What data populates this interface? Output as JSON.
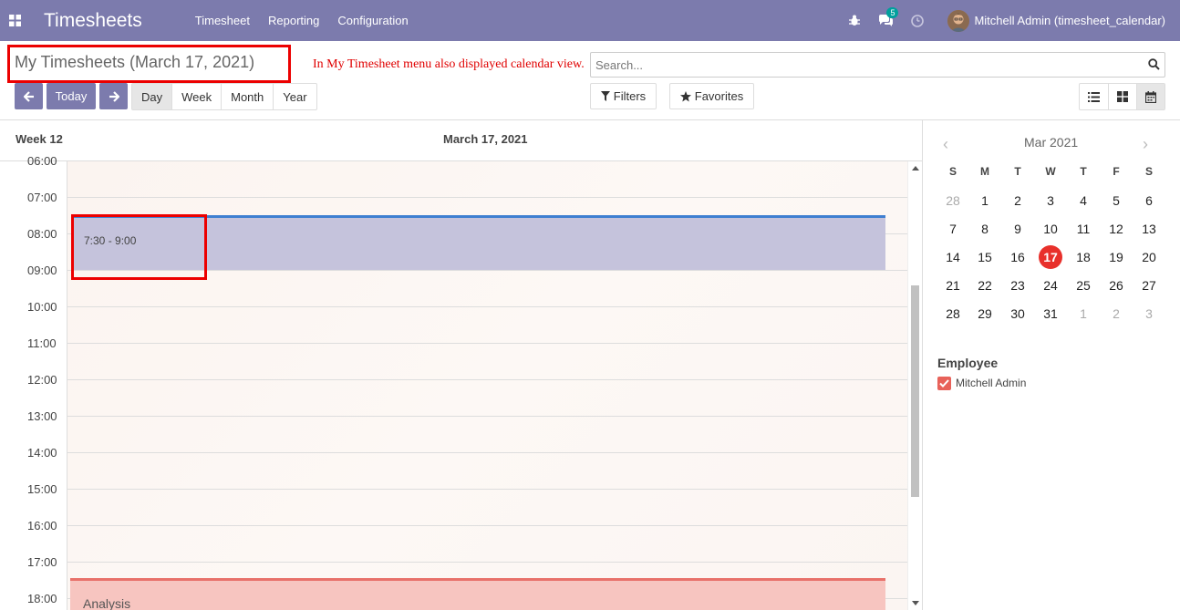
{
  "navbar": {
    "brand": "Timesheets",
    "menu": [
      "Timesheet",
      "Reporting",
      "Configuration"
    ],
    "chat_badge": "5",
    "user": "Mitchell Admin (timesheet_calendar)",
    "icons": [
      "apps-icon",
      "bug-icon",
      "chat-icon",
      "clock-icon"
    ]
  },
  "control": {
    "title": "My Timesheets (March 17, 2021)",
    "annotation": "In My Timesheet menu also displayed calendar view.",
    "search_placeholder": "Search...",
    "today": "Today",
    "scales": [
      "Day",
      "Week",
      "Month",
      "Year"
    ],
    "filters": "Filters",
    "favorites": "Favorites"
  },
  "calendar": {
    "week": "Week 12",
    "date": "March 17, 2021",
    "times": [
      "06:00",
      "07:00",
      "08:00",
      "09:00",
      "10:00",
      "11:00",
      "12:00",
      "13:00",
      "14:00",
      "15:00",
      "16:00",
      "17:00",
      "18:00"
    ],
    "event1": "7:30 - 9:00",
    "event2": "Analysis"
  },
  "mini_calendar": {
    "month": "Mar 2021",
    "dow": [
      "S",
      "M",
      "T",
      "W",
      "T",
      "F",
      "S"
    ],
    "weeks": [
      [
        "28",
        "1",
        "2",
        "3",
        "4",
        "5",
        "6"
      ],
      [
        "7",
        "8",
        "9",
        "10",
        "11",
        "12",
        "13"
      ],
      [
        "14",
        "15",
        "16",
        "17",
        "18",
        "19",
        "20"
      ],
      [
        "21",
        "22",
        "23",
        "24",
        "25",
        "26",
        "27"
      ],
      [
        "28",
        "29",
        "30",
        "31",
        "1",
        "2",
        "3"
      ]
    ],
    "today": "17"
  },
  "filter_panel": {
    "title": "Employee",
    "employee": "Mitchell Admin"
  },
  "colors": {
    "brand": "#7c7bad",
    "today": "#e8302b",
    "event": "#c5c3dc",
    "event_border": "#3f7fd1",
    "annotation": "#e00000"
  }
}
